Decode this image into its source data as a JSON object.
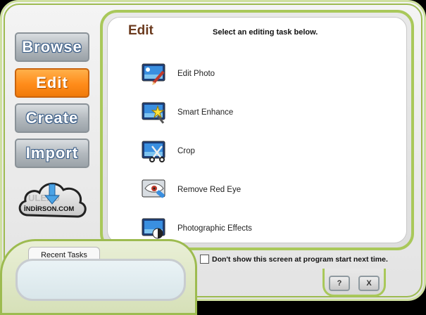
{
  "nav": {
    "browse": "Browse",
    "edit": "Edit",
    "create": "Create",
    "import": "Import",
    "active": "edit"
  },
  "logo": {
    "text_top": "ULEAD",
    "text_bottom": "İNDİRSON.COM"
  },
  "main": {
    "title": "Edit",
    "subtitle": "Select an editing task below.",
    "tasks": [
      {
        "label": "Edit Photo",
        "icon": "edit-photo-icon"
      },
      {
        "label": "Smart Enhance",
        "icon": "smart-enhance-icon"
      },
      {
        "label": "Crop",
        "icon": "crop-icon"
      },
      {
        "label": "Remove Red Eye",
        "icon": "red-eye-icon"
      },
      {
        "label": "Photographic Effects",
        "icon": "photo-effects-icon"
      }
    ]
  },
  "recent": {
    "tab_label": "Recent Tasks"
  },
  "footer": {
    "checkbox_label": "Don't show this screen at program start next time.",
    "checkbox_checked": false,
    "help_label": "?",
    "close_label": "X"
  },
  "colors": {
    "accent_green": "#a9c85a",
    "active_orange": "#ff8c1a",
    "title_brown": "#6b3a1e"
  }
}
